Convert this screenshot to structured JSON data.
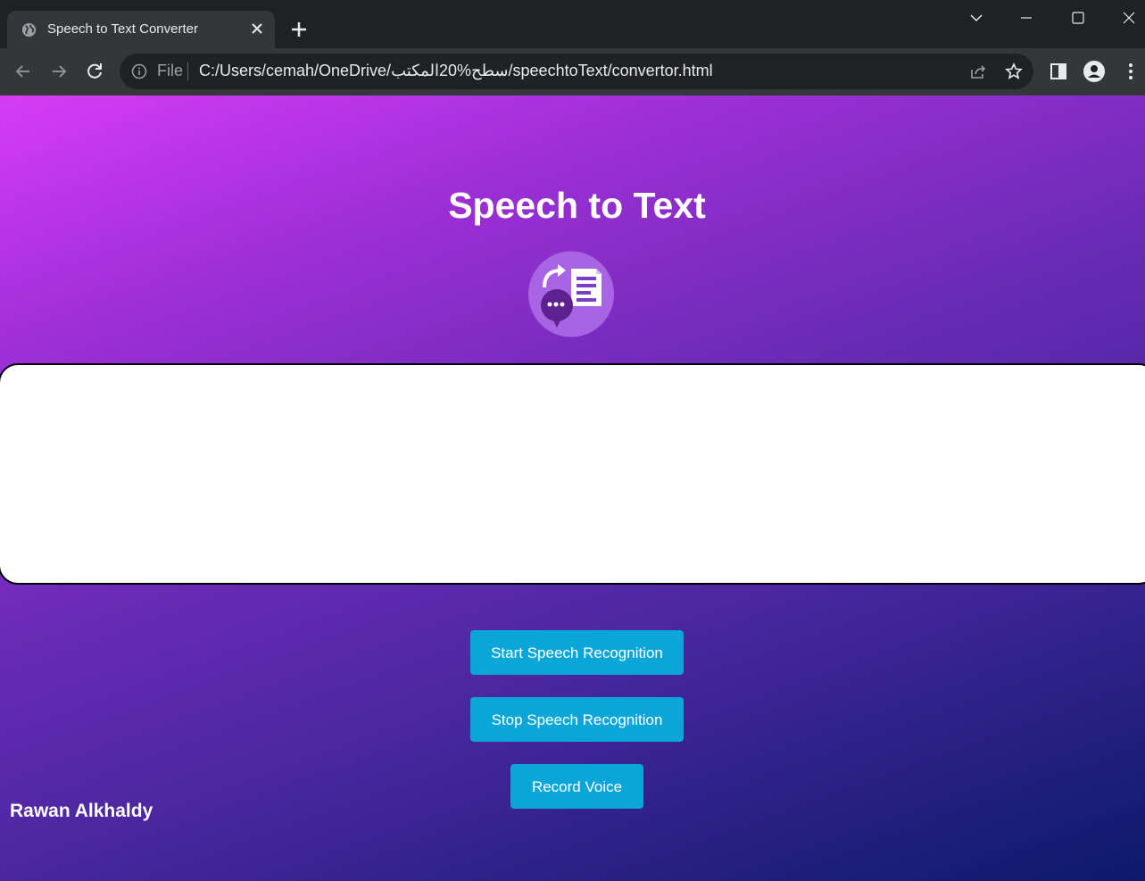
{
  "browser": {
    "tab_title": "Speech to Text Converter",
    "url_scheme_label": "File",
    "url": "C:/Users/cemah/OneDrive/سطح%20المكتب/speechtoText/convertor.html"
  },
  "page": {
    "title": "Speech to Text",
    "transcript_text": "",
    "buttons": {
      "start": "Start Speech Recognition",
      "stop": "Stop Speech Recognition",
      "record": "Record Voice"
    },
    "author": "Rawan Alkhaldy"
  },
  "colors": {
    "button": "#0ba6d8",
    "gradient_start": "#d63cf7",
    "gradient_end": "#0c1a6b"
  },
  "icons": [
    "globe-icon",
    "close-icon",
    "plus-icon",
    "chevron-down-icon",
    "minimize-icon",
    "maximize-icon",
    "window-close-icon",
    "back-arrow-icon",
    "forward-arrow-icon",
    "reload-icon",
    "info-icon",
    "share-icon",
    "star-icon",
    "side-panel-icon",
    "profile-icon",
    "kebab-menu-icon",
    "speech-to-text-logo-icon"
  ]
}
